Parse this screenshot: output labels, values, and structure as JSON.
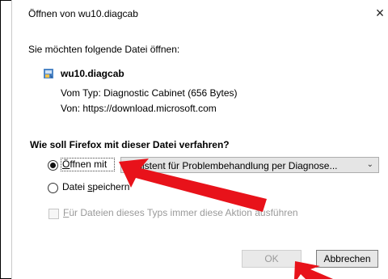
{
  "dialog": {
    "title": "Öffnen von wu10.diagcab",
    "close_glyph": "×"
  },
  "prompt": "Sie möchten folgende Datei öffnen:",
  "file": {
    "name": "wu10.diagcab",
    "type_line": "Vom Typ: Diagnostic Cabinet (656 Bytes)",
    "from_line": "Von: https://download.microsoft.com"
  },
  "question": "Wie soll Firefox mit dieser Datei verfahren?",
  "options": {
    "open_with": {
      "first_char": "Ö",
      "rest": "ffnen mit",
      "selected": true
    },
    "open_with_app": "Assistent für Problembehandlung per Diagnose...",
    "save_file": {
      "prefix": "Datei ",
      "underlined": "s",
      "rest": "peichern",
      "selected": false
    },
    "always": {
      "first_char": "F",
      "rest": "ür Dateien dieses Typs immer diese Aktion ausführen",
      "checked": false
    }
  },
  "buttons": {
    "ok": "OK",
    "cancel": "Abbrechen"
  },
  "annotation_color": "#e8121a"
}
